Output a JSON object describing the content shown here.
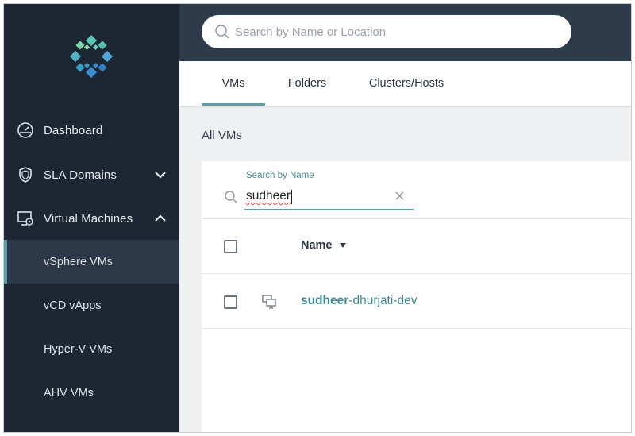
{
  "sidebar": {
    "items": [
      {
        "label": "Dashboard",
        "icon": "dashboard-gauge-icon"
      },
      {
        "label": "SLA Domains",
        "icon": "shield-icon"
      },
      {
        "label": "Virtual Machines",
        "icon": "monitor-icon"
      }
    ],
    "sub_items": [
      {
        "label": "vSphere VMs",
        "active": true
      },
      {
        "label": "vCD vApps",
        "active": false
      },
      {
        "label": "Hyper-V VMs",
        "active": false
      },
      {
        "label": "AHV VMs",
        "active": false
      }
    ]
  },
  "header": {
    "search_placeholder": "Search by Name or Location"
  },
  "tabs": [
    {
      "label": "VMs",
      "active": true
    },
    {
      "label": "Folders",
      "active": false
    },
    {
      "label": "Clusters/Hosts",
      "active": false
    }
  ],
  "main": {
    "section_title": "All VMs",
    "filter": {
      "label": "Search by Name",
      "value": "sudheer"
    },
    "table": {
      "column_name": "Name",
      "rows": [
        {
          "name_match": "sudheer",
          "name_rest": "-dhurjati-dev"
        }
      ]
    }
  },
  "colors": {
    "sidebar_bg": "#1d2734",
    "topbar_bg": "#2e3b4b",
    "accent": "#5a9ea8",
    "link": "#3f8993"
  }
}
